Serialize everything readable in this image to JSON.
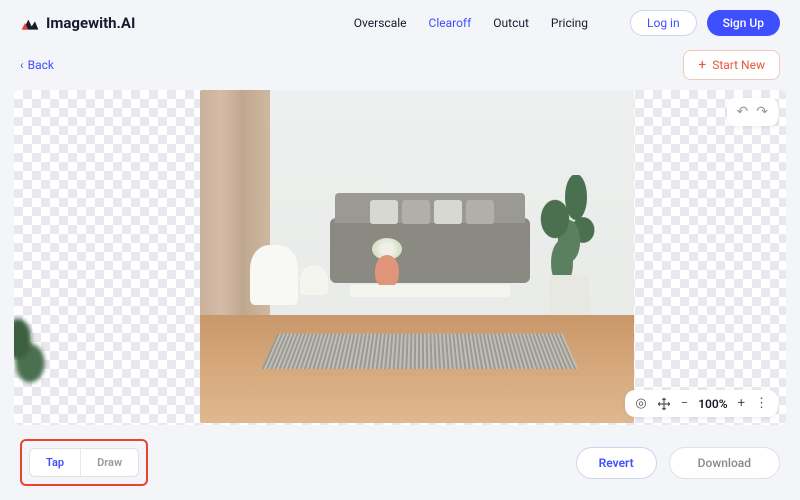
{
  "brand": {
    "name": "Imagewith.AI"
  },
  "nav": {
    "items": [
      {
        "label": "Overscale"
      },
      {
        "label": "Clearoff"
      },
      {
        "label": "Outcut"
      },
      {
        "label": "Pricing"
      }
    ],
    "active_index": 1
  },
  "auth": {
    "login": "Log in",
    "signup": "Sign Up"
  },
  "back": {
    "label": "Back"
  },
  "start_new": {
    "label": "Start New"
  },
  "zoom": {
    "value": "100%"
  },
  "modes": {
    "tap": "Tap",
    "draw": "Draw",
    "active": "tap"
  },
  "actions": {
    "revert": "Revert",
    "download": "Download"
  }
}
